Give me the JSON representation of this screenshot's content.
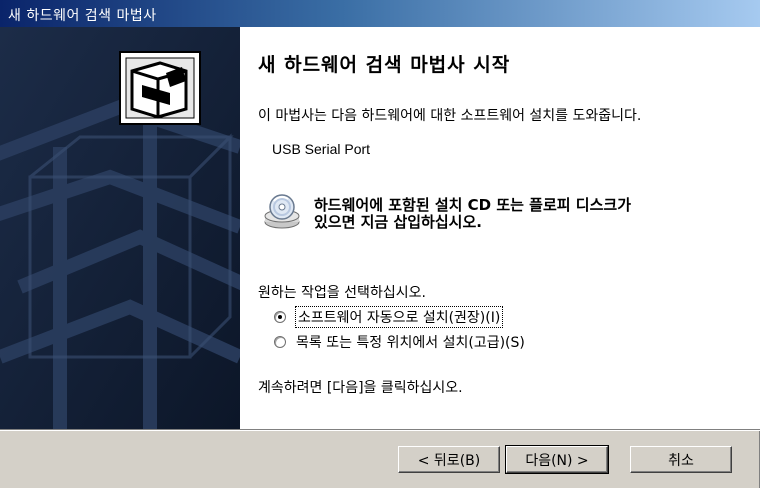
{
  "window": {
    "title": "새 하드웨어 검색 마법사"
  },
  "content": {
    "heading": "새 하드웨어 검색 마법사 시작",
    "description": "이 마법사는 다음 하드웨어에 대한 소프트웨어 설치를 도와줍니다.",
    "device_name": "USB Serial Port",
    "cd_line1": "하드웨어에 포함된 설치 CD 또는 플로피 디스크가",
    "cd_line2": "있으면 지금 삽입하십시오.",
    "prompt": "원하는 작업을 선택하십시오.",
    "options": [
      {
        "label": "소프트웨어 자동으로 설치(권장)(I)",
        "selected": true
      },
      {
        "label": "목록 또는 특정 위치에서 설치(고급)(S)",
        "selected": false
      }
    ],
    "continue_text": "계속하려면 [다음]을 클릭하십시오."
  },
  "buttons": {
    "back": "< 뒤로(B)",
    "next": "다음(N) >",
    "cancel": "취소"
  },
  "colors": {
    "side_panel": "#14223a",
    "title_bar_start": "#0a246a",
    "title_bar_end": "#a6caf0"
  },
  "icons": [
    "hardware-wizard-icon",
    "cd-disc-icon"
  ]
}
